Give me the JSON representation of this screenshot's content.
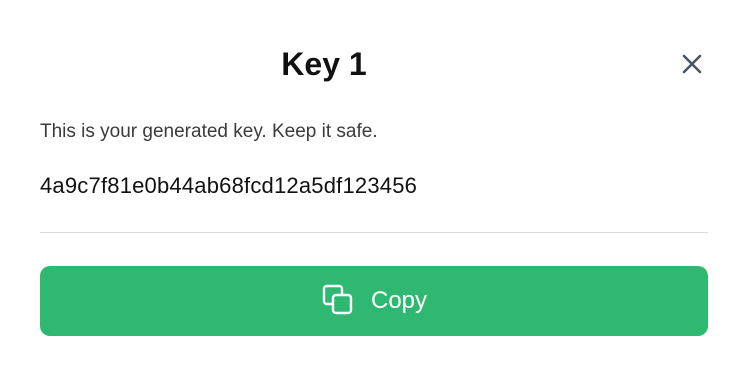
{
  "dialog": {
    "title": "Key 1",
    "description": "This is your generated key. Keep it safe.",
    "key_value": "4a9c7f81e0b44ab68fcd12a5df123456",
    "copy_button_label": "Copy",
    "icons": {
      "close": "close-icon",
      "copy": "copy-icon"
    },
    "colors": {
      "accent": "#2eb872",
      "close_icon": "#4a5563"
    }
  }
}
